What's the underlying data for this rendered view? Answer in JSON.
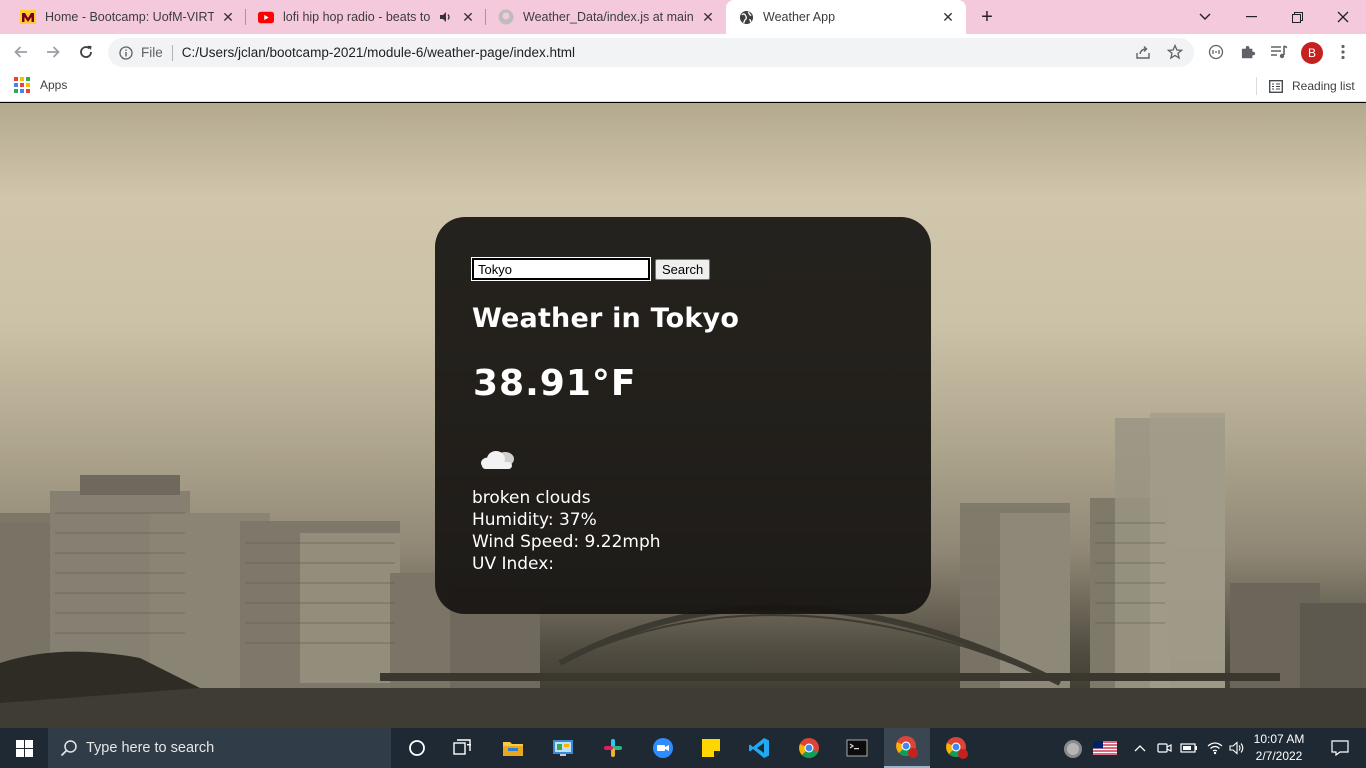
{
  "browser": {
    "tabs": [
      {
        "title": "Home - Bootcamp: UofM-VIRT-B",
        "favicon": "university-m-icon",
        "active": false
      },
      {
        "title": "lofi hip hop radio - beats to r",
        "favicon": "youtube-icon",
        "active": false,
        "audio": true
      },
      {
        "title": "Weather_Data/index.js at main · l",
        "favicon": "github-icon",
        "active": false
      },
      {
        "title": "Weather App",
        "favicon": "globe-icon",
        "active": true
      }
    ],
    "address": {
      "scheme_label": "File",
      "url": "C:/Users/jclan/bootcamp-2021/module-6/weather-page/index.html"
    },
    "profile_initial": "B",
    "bookmarks": {
      "apps_label": "Apps",
      "reading_list_label": "Reading list"
    },
    "colors": {
      "tabstrip": "#f5c9dc",
      "profile": "#c5221f"
    }
  },
  "weather": {
    "search_value": "Tokyo",
    "search_button": "Search",
    "heading": "Weather in Tokyo",
    "temperature": "38.91°F",
    "icon": "broken-clouds-icon",
    "description": "broken clouds",
    "humidity": "Humidity: 37%",
    "wind": "Wind Speed: 9.22mph",
    "uv": "UV Index:"
  },
  "taskbar": {
    "search_placeholder": "Type here to search",
    "apps": [
      "cortana-icon",
      "task-view-icon",
      "file-explorer-icon",
      "control-panel-icon",
      "slack-icon",
      "zoom-icon",
      "sticky-notes-icon",
      "vscode-icon",
      "chrome-icon",
      "terminal-icon",
      "chrome-profile-icon",
      "chrome-profile-icon"
    ],
    "time": "10:07 AM",
    "date": "2/7/2022"
  }
}
